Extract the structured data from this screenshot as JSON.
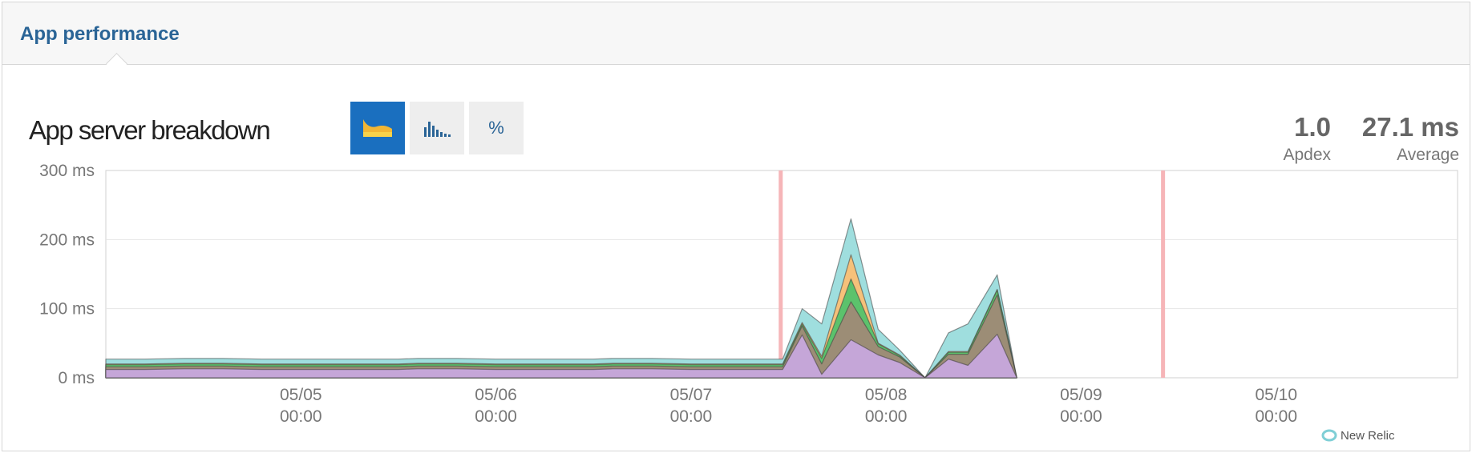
{
  "header": {
    "title": "App performance"
  },
  "chart_title": "App server breakdown",
  "toggles": [
    {
      "name": "area-chart-icon",
      "active": true
    },
    {
      "name": "bar-chart-icon",
      "active": false
    },
    {
      "name": "percent-icon",
      "label": "%",
      "active": false
    }
  ],
  "metrics": {
    "apdex": {
      "value": "1.0",
      "label": "Apdex"
    },
    "average": {
      "value": "27.1 ms",
      "label": "Average"
    }
  },
  "footer": {
    "logo": "New Relic"
  },
  "colors": {
    "purple": "#c5a6d8",
    "brown": "#9c8d76",
    "green": "#5cc26c",
    "orange": "#f6c17a",
    "teal": "#9fdede",
    "marker": "#f6b5b8",
    "accent": "#1a6fbf"
  },
  "chart_data": {
    "type": "area",
    "stacked": true,
    "ylabel_unit": "ms",
    "ylim": [
      0,
      300
    ],
    "xlim": [
      0.0,
      6.93
    ],
    "y_ticks": [
      "0 ms",
      "100 ms",
      "200 ms",
      "300 ms"
    ],
    "x_ticks": [
      {
        "x": 1.0,
        "date": "05/05",
        "time": "00:00"
      },
      {
        "x": 2.0,
        "date": "05/06",
        "time": "00:00"
      },
      {
        "x": 3.0,
        "date": "05/07",
        "time": "00:00"
      },
      {
        "x": 4.0,
        "date": "05/08",
        "time": "00:00"
      },
      {
        "x": 5.0,
        "date": "05/09",
        "time": "00:00"
      },
      {
        "x": 6.0,
        "date": "05/10",
        "time": "00:00"
      }
    ],
    "markers": [
      3.46,
      5.42
    ],
    "x": [
      0.0,
      0.2,
      0.4,
      0.5,
      0.6,
      0.8,
      1.0,
      1.2,
      1.4,
      1.5,
      1.6,
      1.8,
      2.0,
      2.2,
      2.4,
      2.5,
      2.6,
      2.8,
      3.0,
      3.2,
      3.4,
      3.47,
      3.57,
      3.67,
      3.82,
      3.96,
      4.07,
      4.2,
      4.32,
      4.42,
      4.57,
      4.67
    ],
    "series": [
      {
        "color": "purple",
        "values": [
          12,
          12,
          13,
          13,
          13,
          12,
          12,
          12,
          12,
          12,
          13,
          13,
          12,
          12,
          12,
          12,
          13,
          13,
          12,
          12,
          12,
          12,
          62,
          5,
          55,
          33,
          22,
          0,
          27,
          18,
          63,
          0
        ]
      },
      {
        "color": "brown",
        "values": [
          4,
          4,
          4,
          4,
          4,
          4,
          4,
          4,
          4,
          4,
          4,
          4,
          4,
          4,
          4,
          4,
          4,
          4,
          4,
          4,
          4,
          4,
          13,
          15,
          55,
          12,
          8,
          0,
          7,
          16,
          57,
          0
        ]
      },
      {
        "color": "green",
        "values": [
          3,
          3,
          3,
          3,
          3,
          3,
          3,
          3,
          3,
          3,
          3,
          3,
          3,
          3,
          3,
          3,
          3,
          3,
          3,
          3,
          3,
          3,
          3,
          8,
          33,
          4,
          2,
          0,
          3,
          3,
          7,
          0
        ]
      },
      {
        "color": "orange",
        "values": [
          1,
          1,
          1,
          1,
          1,
          1,
          1,
          1,
          1,
          1,
          1,
          1,
          1,
          1,
          1,
          1,
          1,
          1,
          1,
          1,
          1,
          1,
          2,
          3,
          35,
          1,
          1,
          0,
          1,
          1,
          1,
          0
        ]
      },
      {
        "color": "teal",
        "values": [
          7,
          7,
          7,
          7,
          7,
          7,
          7,
          7,
          7,
          7,
          7,
          7,
          7,
          7,
          7,
          7,
          7,
          7,
          7,
          7,
          7,
          7,
          20,
          47,
          52,
          20,
          7,
          0,
          27,
          40,
          21,
          0
        ]
      }
    ]
  }
}
